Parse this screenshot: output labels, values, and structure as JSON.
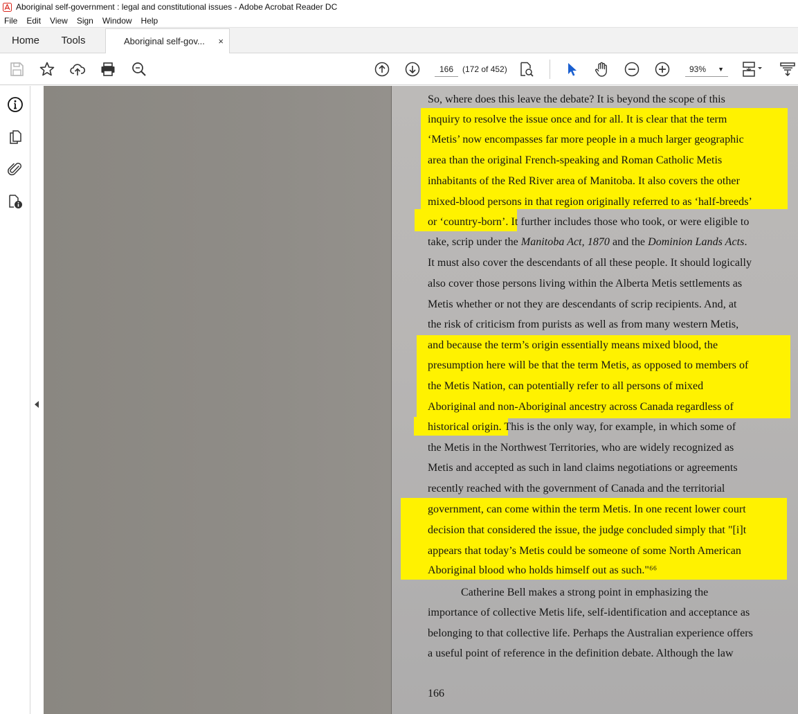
{
  "window": {
    "title": "Aboriginal self-government : legal and constitutional issues - Adobe Acrobat Reader DC"
  },
  "menu": [
    "File",
    "Edit",
    "View",
    "Sign",
    "Window",
    "Help"
  ],
  "tabs": {
    "home": "Home",
    "tools": "Tools",
    "document": "Aboriginal self-gov...",
    "close": "×"
  },
  "toolbar": {
    "page_value": "166",
    "page_count": "(172 of 452)",
    "zoom": "93%"
  },
  "colors": {
    "highlight": "#fff200",
    "select_tool": "#1a5fd0",
    "acrobat_red": "#d8261c"
  },
  "document": {
    "lines": [
      "So, where does this leave the debate? It is beyond the scope of this",
      "inquiry to resolve the issue once and for all. It is clear that the term",
      "‘Metis’ now encompasses far more people in a much larger geographic",
      "area than the original French-speaking and Roman Catholic Metis",
      "inhabitants of the Red River area of Manitoba. It also covers the other",
      "mixed-blood persons in that region originally referred to as ‘half-breeds’",
      "or ‘country-born’. It further includes those who took, or were eligible to",
      "take, scrip under the Manitoba Act, 1870 and the Dominion Lands Acts.",
      "It must also cover the descendants of all these people. It should logically",
      "also cover those persons living within the Alberta Metis settlements as",
      "Metis whether or not they are descendants of scrip recipients. And, at",
      "the risk of criticism from purists as well as from many western Metis,",
      "and because the term’s origin essentially means mixed blood, the",
      "presumption here will be that the term Metis, as opposed to members of",
      "the Metis Nation, can potentially refer to all persons of mixed",
      "Aboriginal and non-Aboriginal ancestry across Canada regardless of",
      "historical origin. This is the only way, for example, in which some of",
      "the Metis in the Northwest Territories, who are widely recognized as",
      "Metis and accepted as such in land claims negotiations or agreements",
      "recently reached with the government of Canada and the territorial",
      "government, can come within the term Metis. In one recent lower court",
      "decision that considered the issue, the judge concluded simply that \"[i]t",
      "appears that today’s Metis could be someone of some North American",
      "Aboriginal blood who holds himself out as such.\"⁶⁶",
      "Catherine Bell makes a strong point in emphasizing the",
      "importance of collective Metis life, self-identification and acceptance as",
      "belonging to that collective life. Perhaps the Australian experience offers",
      "a useful point of reference in the definition debate. Although the law"
    ],
    "page_number": "166"
  }
}
